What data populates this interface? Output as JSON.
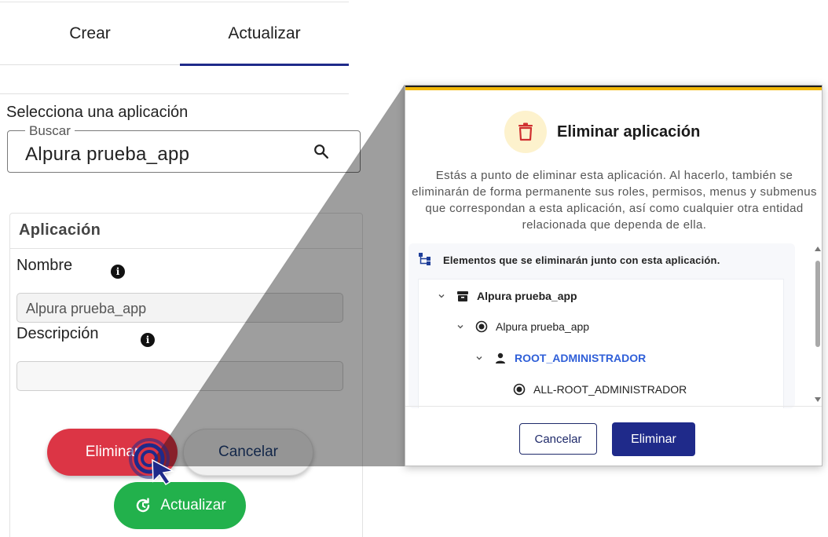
{
  "tabs": [
    {
      "label": "Crear",
      "active": false
    },
    {
      "label": "Actualizar",
      "active": true
    }
  ],
  "select_app": {
    "label": "Selecciona una aplicación",
    "search_legend": "Buscar",
    "search_value": "Alpura prueba_app",
    "search_icon": "search-icon"
  },
  "card": {
    "title": "Aplicación",
    "nombre_label": "Nombre",
    "nombre_value": "Alpura prueba_app",
    "descripcion_label": "Descripción",
    "descripcion_value": "",
    "info_glyph": "i"
  },
  "actions": {
    "eliminar": "Eliminar",
    "cancelar": "Cancelar",
    "actualizar": "Actualizar"
  },
  "modal": {
    "title": "Eliminar aplicación",
    "description": "Estás a punto de eliminar esta aplicación. Al hacerlo, también se eliminarán de forma permanente sus roles, permisos, menus y submenus que correspondan a esta aplicación, así como cualquier otra entidad relacionada que dependa de ella.",
    "tree_header": "Elementos que se eliminarán junto con esta aplicación.",
    "tree": [
      {
        "label": "Alpura prueba_app",
        "icon": "archive-icon",
        "style": "bold"
      },
      {
        "label": "Alpura prueba_app",
        "icon": "radio-icon",
        "style": "normal"
      },
      {
        "label": "ROOT_ADMINISTRADOR",
        "icon": "person-icon",
        "style": "blue"
      },
      {
        "label": "ALL-ROOT_ADMINISTRADOR",
        "icon": "radio-icon",
        "style": "normal"
      }
    ],
    "cancel_label": "Cancelar",
    "delete_label": "Eliminar"
  },
  "colors": {
    "primary": "#1f2a8a",
    "danger": "#dc3545",
    "success": "#22b14c",
    "warning_bar": "#f2b705",
    "link_blue": "#2f5fd8"
  }
}
